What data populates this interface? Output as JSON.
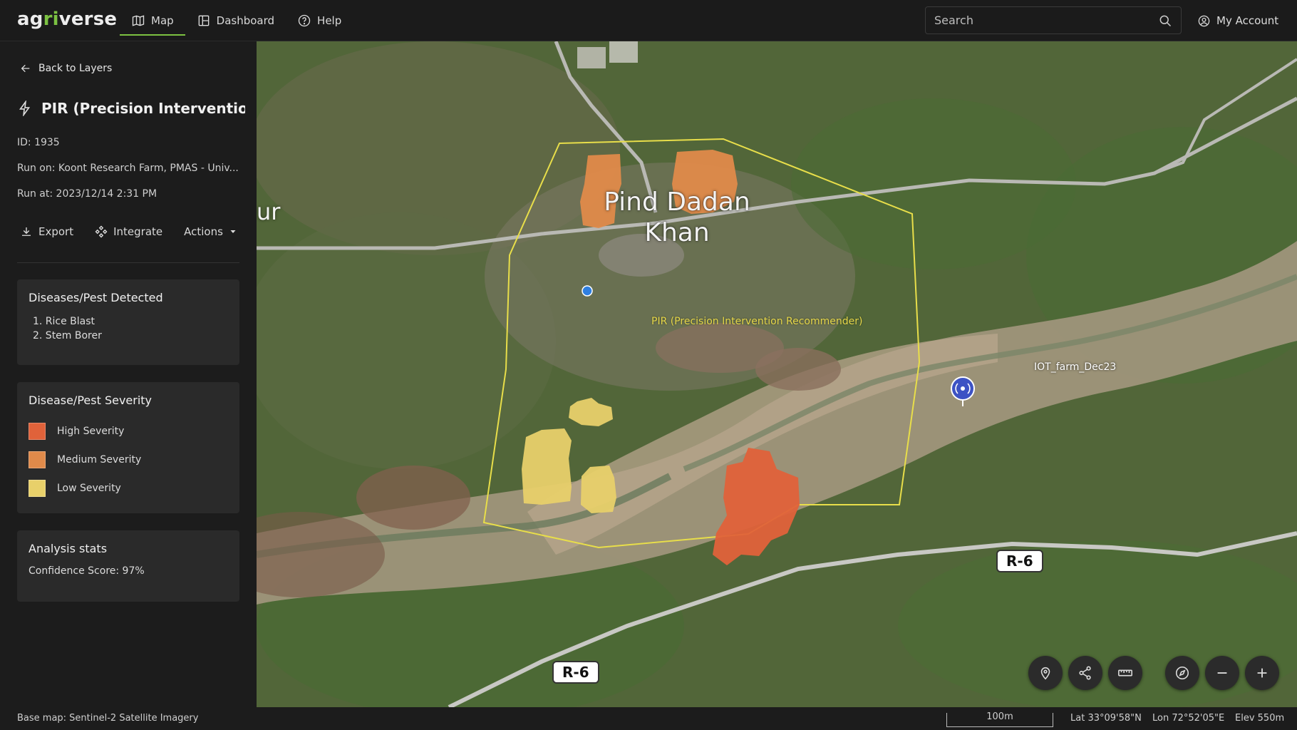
{
  "app": {
    "logo_prefix": "ag",
    "logo_accent": "ri",
    "logo_suffix": "verse"
  },
  "nav": [
    {
      "label": "Map",
      "icon": "map-icon",
      "active": true
    },
    {
      "label": "Dashboard",
      "icon": "dashboard-icon",
      "active": false
    },
    {
      "label": "Help",
      "icon": "help-icon",
      "active": false
    }
  ],
  "search": {
    "placeholder": "Search"
  },
  "account": {
    "label": "My Account"
  },
  "sidebar": {
    "back_label": "Back to Layers",
    "layer_title": "PIR (Precision Interventio...",
    "id_text": "ID: 1935",
    "run_on_text": "Run on: Koont Research Farm, PMAS - Univ...",
    "run_at_text": "Run at: 2023/12/14 2:31 PM",
    "actions": {
      "export": "Export",
      "integrate": "Integrate",
      "more": "Actions"
    },
    "diseases": {
      "title": "Diseases/Pest Detected",
      "items": [
        "1. Rice Blast",
        "2. Stem Borer"
      ]
    },
    "severity": {
      "title": "Disease/Pest Severity",
      "items": [
        {
          "label": "High Severity",
          "color": "#e0623a"
        },
        {
          "label": "Medium Severity",
          "color": "#e08a4a"
        },
        {
          "label": "Low Severity",
          "color": "#e8d06a"
        }
      ]
    },
    "stats": {
      "title": "Analysis stats",
      "confidence": "Confidence Score: 97%"
    }
  },
  "map": {
    "town_line1": "Pind Dadan",
    "town_line2": "Khan",
    "partial_label": "ur",
    "road_label_1": "R-6",
    "road_label_2": "R-6",
    "pir_label": "PIR (Precision Intervention Recommender)",
    "iot_label": "IOT_farm_Dec23",
    "colors": {
      "boundary": "#e8de4a",
      "high": "#e0623a",
      "medium": "#e08a4a",
      "low": "#e8d06a",
      "marker": "#2f7fe0"
    }
  },
  "tools": [
    "location-pin-icon",
    "share-icon",
    "ruler-icon",
    "compass-icon",
    "zoom-out-icon",
    "zoom-in-icon"
  ],
  "footer": {
    "basemap": "Base map: Sentinel-2 Satellite Imagery",
    "scale": "100m",
    "lat": "Lat 33°09'58\"N",
    "lon": "Lon 72°52'05\"E",
    "elev": "Elev 550m"
  }
}
